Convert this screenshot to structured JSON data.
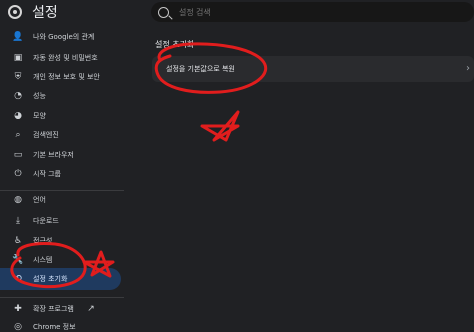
{
  "app": {
    "title": "설정",
    "search_placeholder": "설정 검색"
  },
  "sidebar": {
    "items": [
      {
        "label": "나와 Google의 관계",
        "icon": "person-icon"
      },
      {
        "label": "자동 완성 및 비밀번호",
        "icon": "autofill-icon"
      },
      {
        "label": "개인 정보 보호 및 보안",
        "icon": "shield-icon"
      },
      {
        "label": "성능",
        "icon": "performance-icon"
      },
      {
        "label": "모양",
        "icon": "palette-icon"
      },
      {
        "label": "검색엔진",
        "icon": "search-icon"
      },
      {
        "label": "기본 브라우저",
        "icon": "browser-icon"
      },
      {
        "label": "시작 그룹",
        "icon": "power-icon"
      },
      {
        "label": "언어",
        "icon": "globe-icon"
      },
      {
        "label": "다운로드",
        "icon": "download-icon"
      },
      {
        "label": "접근성",
        "icon": "accessibility-icon"
      },
      {
        "label": "시스템",
        "icon": "wrench-icon"
      },
      {
        "label": "설정 초기화",
        "icon": "reset-icon"
      },
      {
        "label": "확장 프로그램",
        "icon": "extension-icon"
      },
      {
        "label": "Chrome 정보",
        "icon": "chrome-icon"
      }
    ]
  },
  "main": {
    "section_title": "설정 초기화",
    "reset_row_label": "설정을 기본값으로 복원"
  },
  "colors": {
    "background": "#202124",
    "active_item": "#1f3a5f",
    "annotation_red": "#e11d1d"
  }
}
